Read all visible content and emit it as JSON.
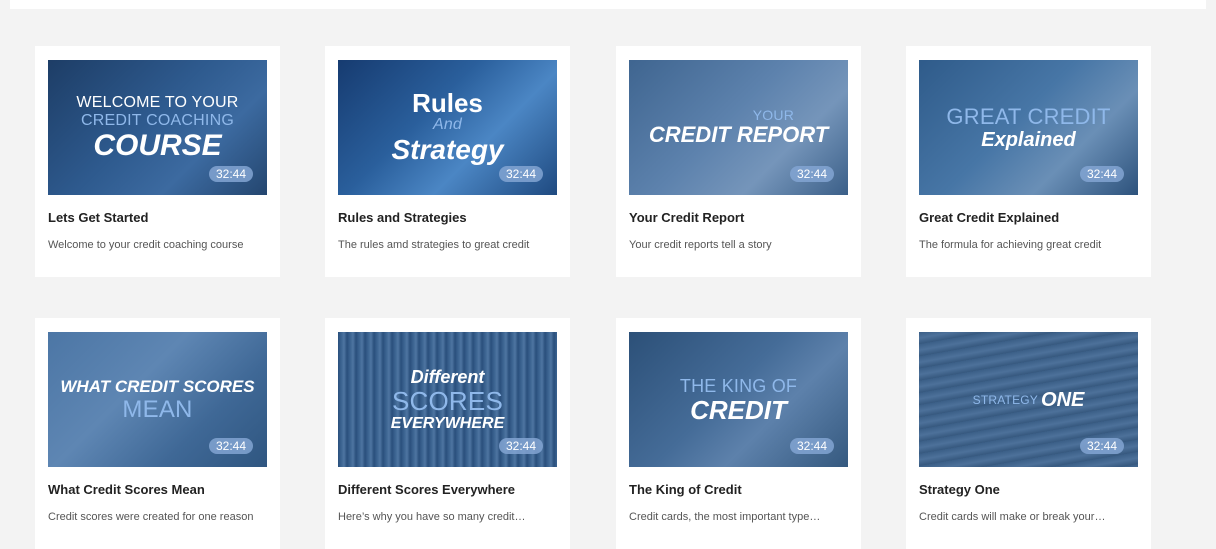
{
  "courses": [
    {
      "thumb_line1": "WELCOME TO YOUR",
      "thumb_line2": "CREDIT COACHING",
      "thumb_line3": "COURSE",
      "duration": "32:44",
      "title": "Lets Get Started",
      "description": "Welcome to your credit coaching course"
    },
    {
      "thumb_line1": "Rules",
      "thumb_line2": "And",
      "thumb_line3": "Strategy",
      "duration": "32:44",
      "title": "Rules and Strategies",
      "description": "The rules amd strategies  to great credit"
    },
    {
      "thumb_line1": "YOUR",
      "thumb_line2": "CREDIT REPORT",
      "duration": "32:44",
      "title": "Your Credit Report",
      "description": "Your credit reports tell a story"
    },
    {
      "thumb_line1": "GREAT CREDIT",
      "thumb_line2": "Explained",
      "duration": "32:44",
      "title": "Great Credit Explained",
      "description": "The formula for achieving great credit"
    },
    {
      "thumb_line1": "WHAT CREDIT SCORES",
      "thumb_line2": "MEAN",
      "duration": "32:44",
      "title": "What Credit Scores Mean",
      "description": "Credit scores were created for one reason"
    },
    {
      "thumb_line1": "Different",
      "thumb_line2": "SCORES",
      "thumb_line3": "EVERYWHERE",
      "duration": "32:44",
      "title": "Different Scores Everywhere",
      "description": "Here’s why you have so many credit…"
    },
    {
      "thumb_line1": "THE KING OF",
      "thumb_line2": "CREDIT",
      "duration": "32:44",
      "title": "The King of Credit",
      "description": "Credit cards, the most important type…"
    },
    {
      "thumb_line1": "STRATEGY",
      "thumb_line2": "ONE",
      "duration": "32:44",
      "title": "Strategy One",
      "description": "Credit cards will make or break your…"
    }
  ]
}
